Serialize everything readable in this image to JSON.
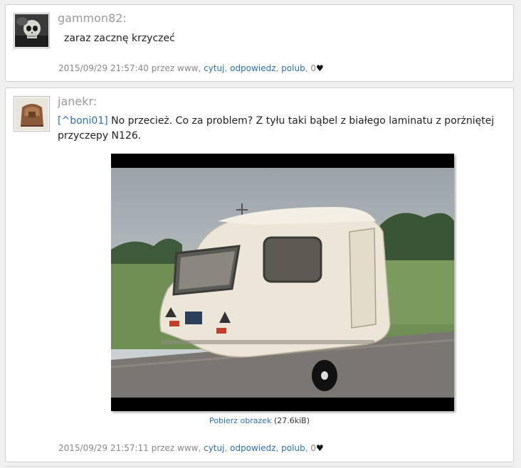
{
  "posts": [
    {
      "author": "gammon82:",
      "text": "zaraz zacznę krzyczeć",
      "meta": {
        "datetime": "2015/09/29 21:57:40",
        "by": "przez www,",
        "quote": "cytuj",
        "reply": "odpowiedz",
        "like": "polub",
        "likes": "0",
        "heart": "♥"
      }
    },
    {
      "author": "janekr:",
      "reply_to": "[^boni01]",
      "text": " No przecież. Co za problem? Z tyłu taki bąbel z białego laminatu z porżniętej przyczepy N126.",
      "download_label": "Pobierz obrazek",
      "download_size": "(27.6kiB)",
      "meta": {
        "datetime": "2015/09/29 21:57:11",
        "by": "przez www,",
        "quote": "cytuj",
        "reply": "odpowiedz",
        "like": "polub",
        "likes": "0",
        "heart": "♥"
      }
    }
  ],
  "sep": ","
}
